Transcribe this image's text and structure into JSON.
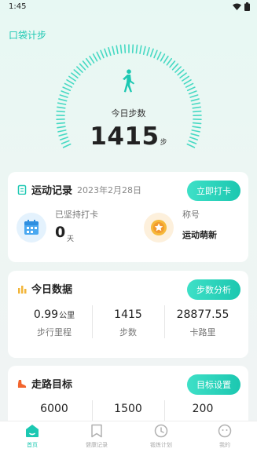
{
  "status": {
    "time": "1:45"
  },
  "app": {
    "title": "口袋计步"
  },
  "gauge": {
    "label": "今日步数",
    "steps": "1415",
    "unit": "步"
  },
  "record_card": {
    "title": "运动记录",
    "date": "2023年2月28日",
    "button": "立即打卡",
    "streak_label": "已坚持打卡",
    "streak_value": "0",
    "streak_unit": "天",
    "title_label": "称号",
    "title_value": "运动萌新"
  },
  "today_card": {
    "title": "今日数据",
    "button": "步数分析",
    "metrics": [
      {
        "value": "0.99",
        "unit": "公里",
        "label": "步行里程"
      },
      {
        "value": "1415",
        "unit": "",
        "label": "步数"
      },
      {
        "value": "28877.55",
        "unit": "",
        "label": "卡路里"
      }
    ]
  },
  "goal_card": {
    "title": "走路目标",
    "button": "目标设置",
    "values": [
      "6000",
      "1500",
      "200"
    ]
  },
  "tabbar": {
    "items": [
      {
        "label": "首页",
        "active": true
      },
      {
        "label": "健康记录",
        "active": false
      },
      {
        "label": "锻炼计划",
        "active": false
      },
      {
        "label": "我的",
        "active": false
      }
    ]
  },
  "colors": {
    "accent": "#1cc8b2",
    "orange": "#f29a2e",
    "blue": "#4aa8f0"
  }
}
